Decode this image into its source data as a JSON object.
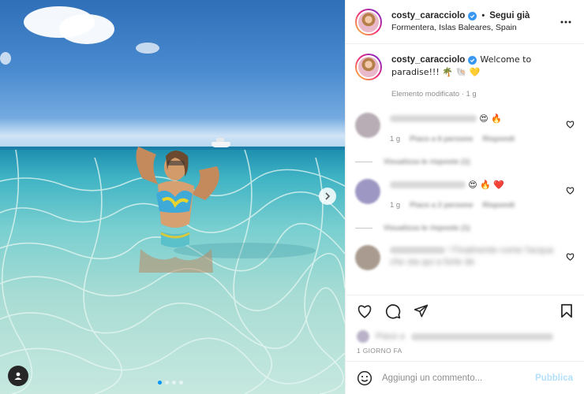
{
  "post": {
    "username": "costy_caracciolo",
    "follow_separator": "•",
    "follow_label": "Segui già",
    "location": "Formentera, Islas Baleares, Spain",
    "image_count": 4,
    "active_image": 0
  },
  "caption": {
    "username": "costy_caracciolo",
    "text": "Welcome to paradise!!! 🌴 🐚 💛",
    "edited": "Elemento modificato · 1 g"
  },
  "comments": [
    {
      "username": "",
      "text": "",
      "emojis": "😍 🔥",
      "time": "1 g",
      "likes": "Piace a 6 persone",
      "reply": "Rispondi",
      "view_replies": "Visualizza le risposte (1)"
    },
    {
      "username": "",
      "text": "",
      "emojis": "😍 🔥 ❤️",
      "time": "1 g",
      "likes": "Piace a 2 persone",
      "reply": "Rispondi",
      "view_replies": "Visualizza le risposte (1)"
    },
    {
      "username": "",
      "text": "! Finalmente come l'acqua che sta qui a forte de"
    }
  ],
  "likes_text": "Piace a",
  "time_ago": "1 GIORNO FA",
  "add_comment": {
    "placeholder": "Aggiungi un commento...",
    "publish_label": "Pubblica"
  },
  "colors": {
    "accent": "#0095f6",
    "publish_disabled": "#b2dffc",
    "verified": "#3897f0"
  }
}
